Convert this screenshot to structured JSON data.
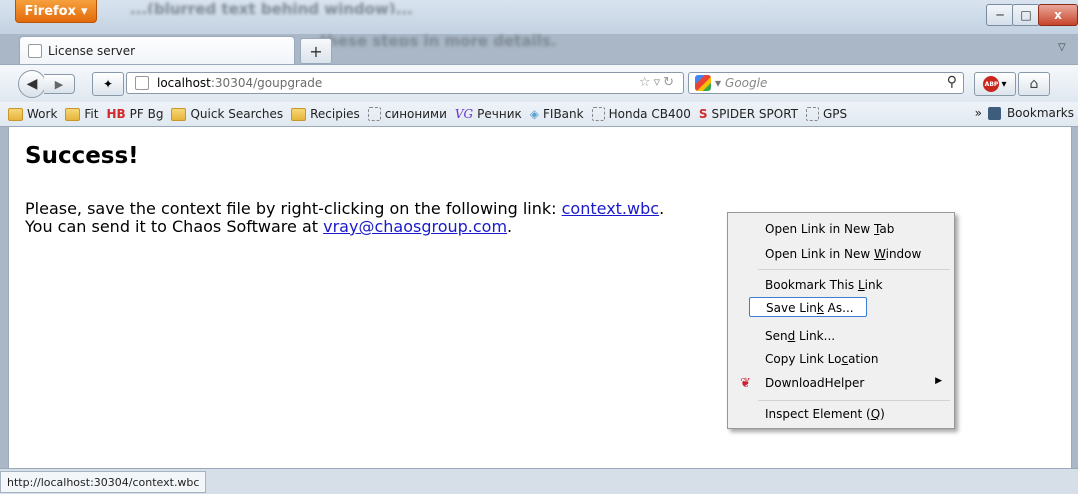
{
  "window": {
    "firefox_label": "Firefox",
    "minimize_glyph": "─",
    "maximize_glyph": "□",
    "close_glyph": "x",
    "background_text": "...(blurred text behind window)..."
  },
  "tabs": [
    {
      "title": "License server"
    }
  ],
  "navbar": {
    "url_host": "localhost",
    "url_rest": ":30304/goupgrade",
    "search_placeholder": "Google"
  },
  "bookmarks": [
    {
      "label": "Work",
      "icon": "folder-icon"
    },
    {
      "label": "Fit",
      "icon": "folder-icon"
    },
    {
      "prefix": "HB",
      "label": "PF Bg",
      "icon": "hb-icon"
    },
    {
      "label": "Quick Searches",
      "icon": "folder-icon"
    },
    {
      "label": "Recipies",
      "icon": "folder-icon"
    },
    {
      "label": "синоними",
      "icon": "page-icon"
    },
    {
      "prefix": "VG",
      "label": "Речник",
      "icon": "vg-icon"
    },
    {
      "label": "FIBank",
      "icon": "fibank-icon"
    },
    {
      "label": "Honda CB400",
      "icon": "page-icon"
    },
    {
      "prefix": "S",
      "label": "SPIDER SPORT",
      "icon": "spider-icon"
    },
    {
      "label": "GPS",
      "icon": "page-icon"
    }
  ],
  "bookmarks_overflow": "»",
  "bookmarks_menu": "Bookmarks",
  "page": {
    "heading": "Success!",
    "line1_text": "Please, save the context file by right-clicking on the following link: ",
    "line1_link": "context.wbc",
    "line1_end": ".",
    "line2_text": "You can send it to Chaos Software at ",
    "line2_link": "vray@chaosgroup.com",
    "line2_end": "."
  },
  "status": {
    "text": "http://localhost:30304/context.wbc"
  },
  "context_menu": {
    "items": [
      {
        "pre": "Open Link in New ",
        "key": "T",
        "post": "ab"
      },
      {
        "pre": "Open Link in New ",
        "key": "W",
        "post": "indow"
      },
      {
        "pre": "Bookmark This ",
        "key": "L",
        "post": "ink"
      },
      {
        "pre": "Save Lin",
        "key": "k",
        "post": " As..."
      },
      {
        "pre": "Sen",
        "key": "d",
        "post": " Link..."
      },
      {
        "pre": "Copy Link Lo",
        "key": "c",
        "post": "ation"
      },
      {
        "pre": "DownloadHelper",
        "key": "",
        "post": ""
      },
      {
        "pre": "Inspect Element (",
        "key": "Q",
        "post": ")"
      }
    ],
    "focused_item": "Save Link As..."
  },
  "colors": {
    "firefox_orange": "#e46a0c",
    "link_blue": "#1a1acc",
    "focus_border": "#3a7ed6",
    "close_red": "#c8442b"
  }
}
